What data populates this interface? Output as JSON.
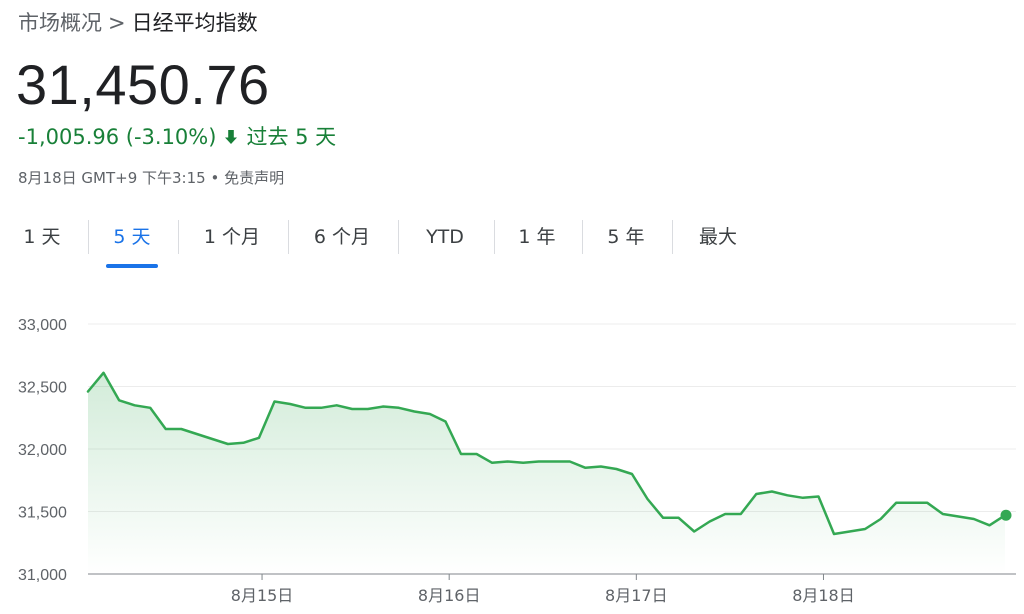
{
  "breadcrumb": {
    "parent": "市场概况",
    "separator": ">",
    "current": "日经平均指数"
  },
  "price": "31,450.76",
  "change": {
    "value": "-1,005.96 (-3.10%)",
    "direction_icon": "arrow-down-icon",
    "period": "过去 5 天"
  },
  "meta": "8月18日 GMT+9 下午3:15 • 免责声明",
  "tabs": [
    "1 天",
    "5 天",
    "1 个月",
    "6 个月",
    "YTD",
    "1 年",
    "5 年",
    "最大"
  ],
  "active_tab": 1,
  "colors": {
    "up_down_green": "#188038",
    "line": "#34a853",
    "accent": "#1a73e8"
  },
  "chart_data": {
    "type": "area",
    "title": "",
    "xlabel": "",
    "ylabel": "",
    "ylim": [
      31000,
      33000
    ],
    "yticks": [
      31000,
      31500,
      32000,
      32500,
      33000
    ],
    "ytick_labels": [
      "31,000",
      "31,500",
      "32,000",
      "32,500",
      "33,000"
    ],
    "x_labels": [
      "8月15日",
      "8月16日",
      "8月17日",
      "8月18日"
    ],
    "x_label_positions": [
      9.3,
      19.3,
      29.3,
      39.3
    ],
    "x_range": [
      0,
      49
    ],
    "grid": true,
    "values": [
      32460,
      32610,
      32390,
      32350,
      32330,
      32160,
      32160,
      32120,
      32080,
      32040,
      32050,
      32090,
      32380,
      32360,
      32330,
      32330,
      32350,
      32320,
      32320,
      32340,
      32330,
      32300,
      32280,
      32220,
      31960,
      31960,
      31890,
      31900,
      31890,
      31900,
      31900,
      31900,
      31850,
      31860,
      31840,
      31800,
      31600,
      31450,
      31450,
      31340,
      31420,
      31480,
      31480,
      31640,
      31660,
      31630,
      31610,
      31620,
      31320,
      31340,
      31360,
      31440,
      31570,
      31570,
      31570,
      31480,
      31460,
      31440,
      31390,
      31470
    ]
  }
}
